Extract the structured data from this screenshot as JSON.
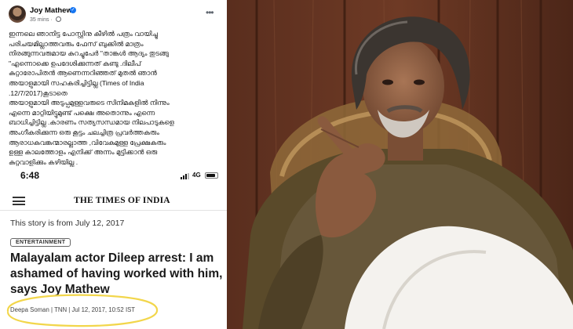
{
  "facebook_post": {
    "author": "Joy Mathew",
    "time": "35 mins",
    "more_icon": "ellipsis-icon",
    "text": "ഇന്നലെ ഞാനിട്ട പോസ്റ്റിനു കീഴിൽ പത്രം വായിച്ചു\nപരിചയമില്ലാത്തവരും ഫേസ് ബുക്കിൽ മാത്രം\nനിരങ്ങുന്നവരുമായ കുറച്ചുപേർ \"താങ്കൾ ആദ്യം തുടങ്ങു\n\"എന്നൊക്കെ ഉപദേശിക്കുന്നത് കണ്ടു .ദിലീപ്\nകുറ്റാരോപിതൻ ആണെന്നറിഞ്ഞത് മുതൽ ഞാൻ\nഅയാളുമായി സഹകരിച്ചിട്ടില്ല (Times of India\n.12/7/2017)കൂടാതെ\nഅയാളുമായി അടുപ്പമുള്ളവരുടെ സിനിമകളിൽ നിന്നും\nഎന്നെ മാറ്റിയിട്ടുമുണ്ട് പക്ഷെ അതൊന്നും എന്നെ\nബാധിച്ചിട്ടില്ല .കാരണം സത്യസന്ധമായ നിലപാടുകളെ\nഅംഗീകരിക്കുന്ന ഒരു കൂട്ടം ചലച്ചിത്ര പ്രവർത്തകരും\nആരാധകവങ്കന്മാരല്ലാത്ത ,വിവേകമുള്ള പ്രേക്ഷകരും\nഉള്ള കാലത്തോളം എനിക്ക് അന്നം മുട്ടിക്കാൻ ഒരു\nകുറ്റവാളിക്കും കഴിയില്ല ."
  },
  "phone": {
    "time": "6:48",
    "network": "4G",
    "site_title": "THE TIMES OF INDIA",
    "story_date": "This story is from July 12, 2017",
    "category": "ENTERTAINMENT",
    "headline": "Malayalam actor Dileep arrest: I am ashamed of having worked with him, says Joy Mathew",
    "byline": "Deepa Soman | TNN | Jul 12, 2017, 10:52 IST",
    "highlight_color": "#f2d64b"
  },
  "photo": {
    "subject": "man-in-brown-kurta-photo"
  }
}
